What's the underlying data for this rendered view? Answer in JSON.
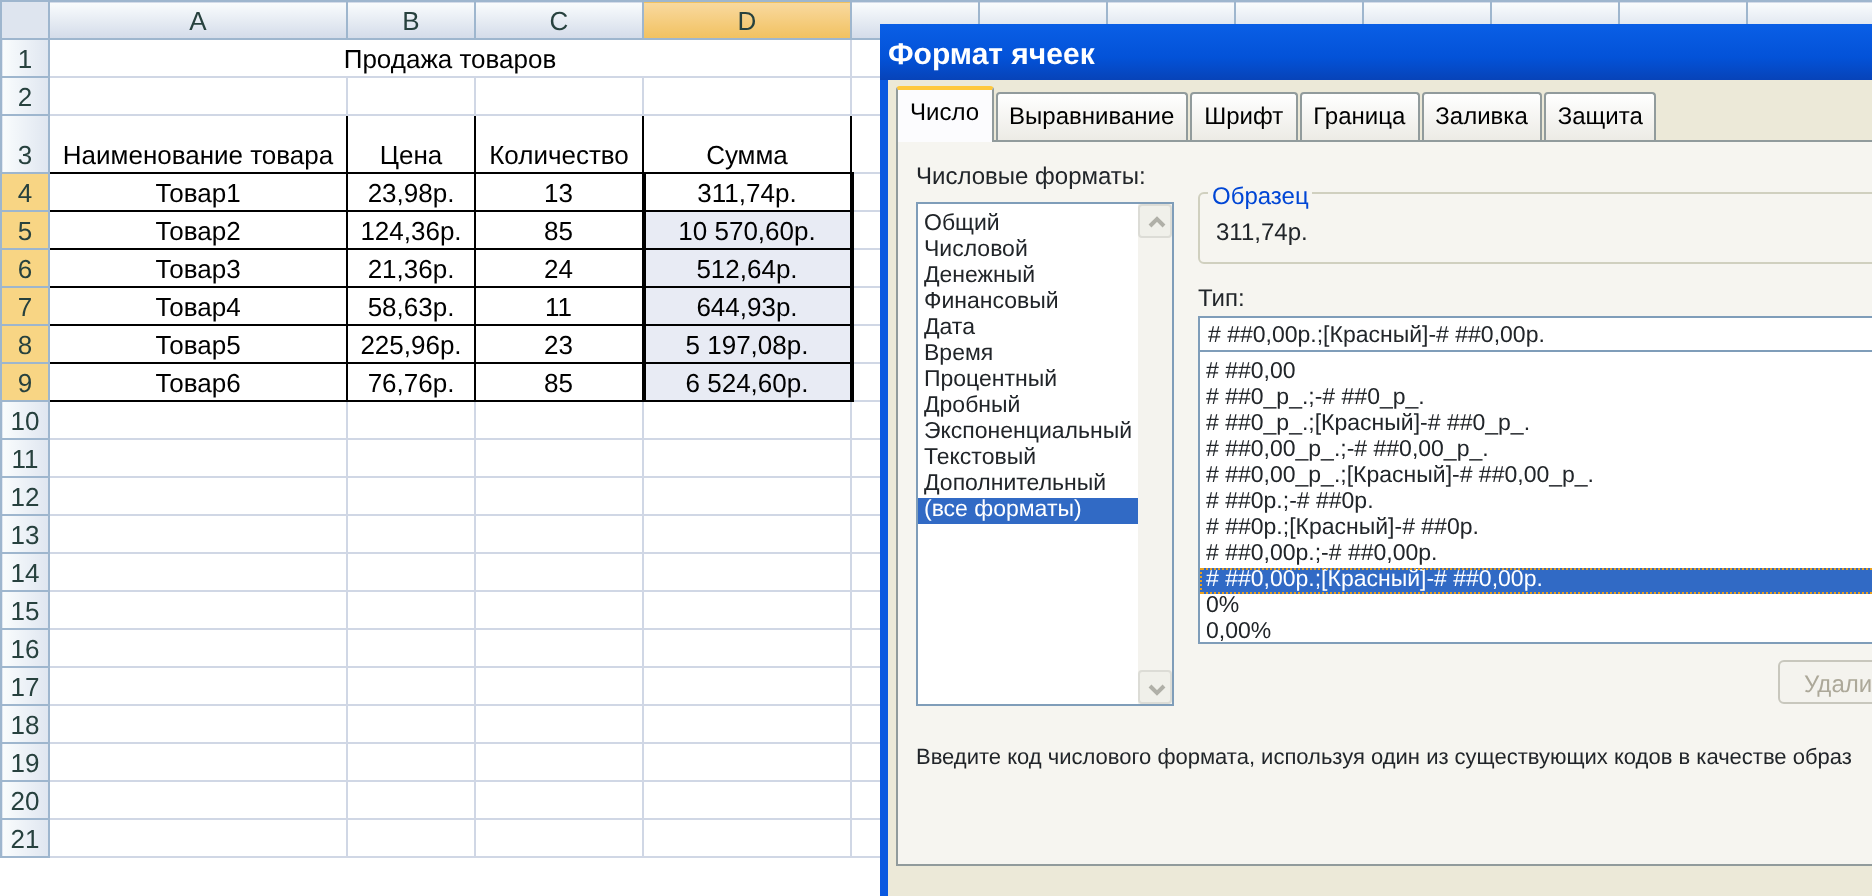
{
  "sheet": {
    "columns": [
      {
        "label": "A",
        "selected": false
      },
      {
        "label": "B",
        "selected": false
      },
      {
        "label": "C",
        "selected": false
      },
      {
        "label": "D",
        "selected": true
      }
    ],
    "row_numbers": [
      {
        "label": "1",
        "selected": false
      },
      {
        "label": "2",
        "selected": false
      },
      {
        "label": "3",
        "selected": false
      },
      {
        "label": "4",
        "selected": true
      },
      {
        "label": "5",
        "selected": true
      },
      {
        "label": "6",
        "selected": true
      },
      {
        "label": "7",
        "selected": true
      },
      {
        "label": "8",
        "selected": true
      },
      {
        "label": "9",
        "selected": true
      },
      {
        "label": "10",
        "selected": false
      },
      {
        "label": "11",
        "selected": false
      },
      {
        "label": "12",
        "selected": false
      },
      {
        "label": "13",
        "selected": false
      },
      {
        "label": "14",
        "selected": false
      },
      {
        "label": "15",
        "selected": false
      },
      {
        "label": "16",
        "selected": false
      },
      {
        "label": "17",
        "selected": false
      },
      {
        "label": "18",
        "selected": false
      },
      {
        "label": "19",
        "selected": false
      },
      {
        "label": "20",
        "selected": false
      },
      {
        "label": "21",
        "selected": false
      }
    ],
    "title": "Продажа товаров",
    "headers": [
      "Наименование товара",
      "Цена",
      "Количество",
      "Сумма"
    ],
    "rows": [
      {
        "name": "Товар1",
        "price": "23,98р.",
        "qty": "13",
        "sum": "311,74р.",
        "selected": true,
        "active": true
      },
      {
        "name": "Товар2",
        "price": "124,36р.",
        "qty": "85",
        "sum": "10 570,60р.",
        "selected": true,
        "active": false
      },
      {
        "name": "Товар3",
        "price": "21,36р.",
        "qty": "24",
        "sum": "512,64р.",
        "selected": true,
        "active": false
      },
      {
        "name": "Товар4",
        "price": "58,63р.",
        "qty": "11",
        "sum": "644,93р.",
        "selected": true,
        "active": false
      },
      {
        "name": "Товар5",
        "price": "225,96р.",
        "qty": "23",
        "sum": "5 197,08р.",
        "selected": true,
        "active": false
      },
      {
        "name": "Товар6",
        "price": "76,76р.",
        "qty": "85",
        "sum": "6 524,60р.",
        "selected": true,
        "active": false
      }
    ]
  },
  "dialog": {
    "title": "Формат ячеек",
    "tabs": [
      {
        "label": "Число",
        "selected": true
      },
      {
        "label": "Выравнивание",
        "selected": false
      },
      {
        "label": "Шрифт",
        "selected": false
      },
      {
        "label": "Граница",
        "selected": false
      },
      {
        "label": "Заливка",
        "selected": false
      },
      {
        "label": "Защита",
        "selected": false
      }
    ],
    "categories_label": "Числовые форматы:",
    "categories": [
      {
        "label": "Общий",
        "selected": false
      },
      {
        "label": "Числовой",
        "selected": false
      },
      {
        "label": "Денежный",
        "selected": false
      },
      {
        "label": "Финансовый",
        "selected": false
      },
      {
        "label": "Дата",
        "selected": false
      },
      {
        "label": "Время",
        "selected": false
      },
      {
        "label": "Процентный",
        "selected": false
      },
      {
        "label": "Дробный",
        "selected": false
      },
      {
        "label": "Экспоненциальный",
        "selected": false
      },
      {
        "label": "Текстовый",
        "selected": false
      },
      {
        "label": "Дополнительный",
        "selected": false
      },
      {
        "label": "(все форматы)",
        "selected": true
      }
    ],
    "sample_legend": "Образец",
    "sample_value": "311,74р.",
    "type_label": "Тип:",
    "type_value": "# ##0,00р.;[Красный]-# ##0,00р.",
    "format_codes": [
      {
        "label": "# ##0,00",
        "selected": false
      },
      {
        "label": "# ##0_р_.;-# ##0_р_.",
        "selected": false
      },
      {
        "label": "# ##0_р_.;[Красный]-# ##0_р_.",
        "selected": false
      },
      {
        "label": "# ##0,00_р_.;-# ##0,00_р_.",
        "selected": false
      },
      {
        "label": "# ##0,00_р_.;[Красный]-# ##0,00_р_.",
        "selected": false
      },
      {
        "label": "# ##0р.;-# ##0р.",
        "selected": false
      },
      {
        "label": "# ##0р.;[Красный]-# ##0р.",
        "selected": false
      },
      {
        "label": "# ##0,00р.;-# ##0,00р.",
        "selected": false
      },
      {
        "label": "# ##0,00р.;[Красный]-# ##0,00р.",
        "selected": true
      },
      {
        "label": "0%",
        "selected": false
      },
      {
        "label": "0,00%",
        "selected": false
      }
    ],
    "delete_button": {
      "label": "Удали",
      "disabled": true
    },
    "hint": "Введите код числового формата, используя один из существующих кодов в качестве образ"
  }
}
